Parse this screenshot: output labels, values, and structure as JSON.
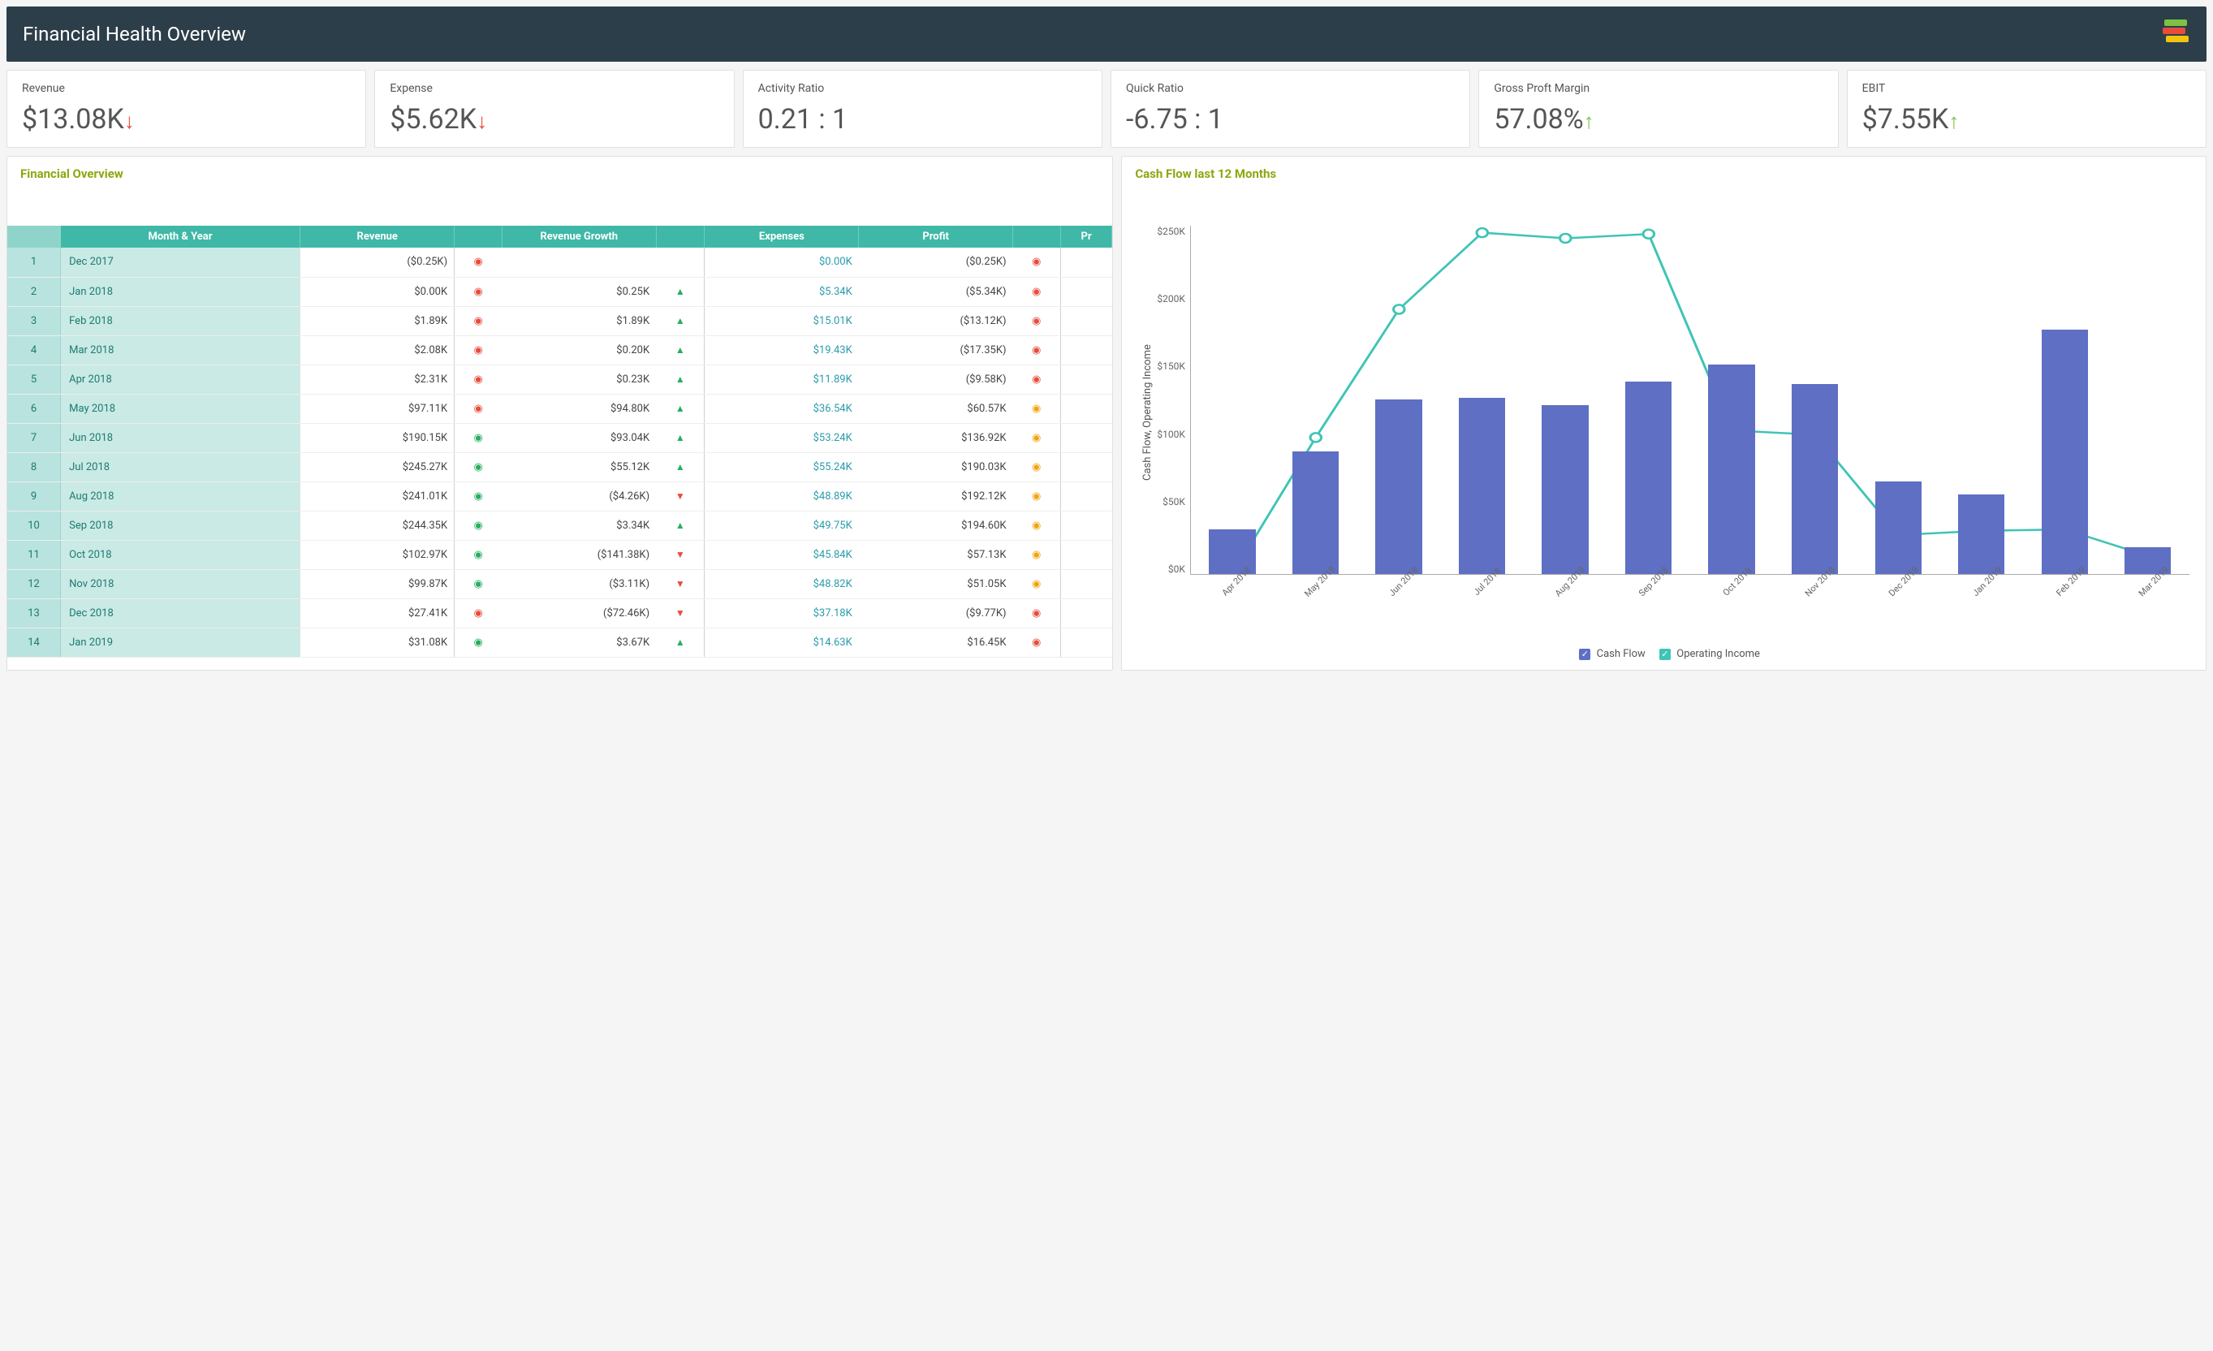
{
  "header": {
    "title": "Financial Health Overview"
  },
  "kpis": [
    {
      "label": "Revenue",
      "value": "$13.08K",
      "arrow": "down"
    },
    {
      "label": "Expense",
      "value": "$5.62K",
      "arrow": "down"
    },
    {
      "label": "Activity Ratio",
      "value": "0.21 : 1",
      "arrow": "none"
    },
    {
      "label": "Quick Ratio",
      "value": "-6.75 : 1",
      "arrow": "none"
    },
    {
      "label": "Gross Proft Margin",
      "value": "57.08%",
      "arrow": "up"
    },
    {
      "label": "EBIT",
      "value": "$7.55K",
      "arrow": "up"
    }
  ],
  "financial_overview": {
    "title": "Financial Overview",
    "columns": [
      "",
      "Month & Year",
      "Revenue",
      "",
      "Revenue Growth",
      "",
      "Expenses",
      "Profit",
      "",
      "Pr"
    ],
    "rows": [
      {
        "n": 1,
        "month": "Dec 2017",
        "rev": "($0.25K)",
        "revInd": "red",
        "growth": "",
        "growthDir": "",
        "exp": "$0.00K",
        "profit": "($0.25K)",
        "profInd": "red"
      },
      {
        "n": 2,
        "month": "Jan 2018",
        "rev": "$0.00K",
        "revInd": "red",
        "growth": "$0.25K",
        "growthDir": "up",
        "exp": "$5.34K",
        "profit": "($5.34K)",
        "profInd": "red"
      },
      {
        "n": 3,
        "month": "Feb 2018",
        "rev": "$1.89K",
        "revInd": "red",
        "growth": "$1.89K",
        "growthDir": "up",
        "exp": "$15.01K",
        "profit": "($13.12K)",
        "profInd": "red"
      },
      {
        "n": 4,
        "month": "Mar 2018",
        "rev": "$2.08K",
        "revInd": "red",
        "growth": "$0.20K",
        "growthDir": "up",
        "exp": "$19.43K",
        "profit": "($17.35K)",
        "profInd": "red"
      },
      {
        "n": 5,
        "month": "Apr 2018",
        "rev": "$2.31K",
        "revInd": "red",
        "growth": "$0.23K",
        "growthDir": "up",
        "exp": "$11.89K",
        "profit": "($9.58K)",
        "profInd": "red"
      },
      {
        "n": 6,
        "month": "May 2018",
        "rev": "$97.11K",
        "revInd": "red",
        "growth": "$94.80K",
        "growthDir": "up",
        "exp": "$36.54K",
        "profit": "$60.57K",
        "profInd": "yellow"
      },
      {
        "n": 7,
        "month": "Jun 2018",
        "rev": "$190.15K",
        "revInd": "green",
        "growth": "$93.04K",
        "growthDir": "up",
        "exp": "$53.24K",
        "profit": "$136.92K",
        "profInd": "yellow"
      },
      {
        "n": 8,
        "month": "Jul 2018",
        "rev": "$245.27K",
        "revInd": "green",
        "growth": "$55.12K",
        "growthDir": "up",
        "exp": "$55.24K",
        "profit": "$190.03K",
        "profInd": "yellow"
      },
      {
        "n": 9,
        "month": "Aug 2018",
        "rev": "$241.01K",
        "revInd": "green",
        "growth": "($4.26K)",
        "growthDir": "down",
        "exp": "$48.89K",
        "profit": "$192.12K",
        "profInd": "yellow"
      },
      {
        "n": 10,
        "month": "Sep 2018",
        "rev": "$244.35K",
        "revInd": "green",
        "growth": "$3.34K",
        "growthDir": "up",
        "exp": "$49.75K",
        "profit": "$194.60K",
        "profInd": "yellow"
      },
      {
        "n": 11,
        "month": "Oct 2018",
        "rev": "$102.97K",
        "revInd": "green",
        "growth": "($141.38K)",
        "growthDir": "down",
        "exp": "$45.84K",
        "profit": "$57.13K",
        "profInd": "yellow"
      },
      {
        "n": 12,
        "month": "Nov 2018",
        "rev": "$99.87K",
        "revInd": "green",
        "growth": "($3.11K)",
        "growthDir": "down",
        "exp": "$48.82K",
        "profit": "$51.05K",
        "profInd": "yellow"
      },
      {
        "n": 13,
        "month": "Dec 2018",
        "rev": "$27.41K",
        "revInd": "red",
        "growth": "($72.46K)",
        "growthDir": "down",
        "exp": "$37.18K",
        "profit": "($9.77K)",
        "profInd": "red"
      },
      {
        "n": 14,
        "month": "Jan 2019",
        "rev": "$31.08K",
        "revInd": "green",
        "growth": "$3.67K",
        "growthDir": "up",
        "exp": "$14.63K",
        "profit": "$16.45K",
        "profInd": "red"
      }
    ]
  },
  "chart": {
    "title": "Cash Flow last 12 Months",
    "ylabel": "Cash Flow, Operating Income",
    "legend": {
      "bar": "Cash Flow",
      "line": "Operating Income"
    }
  },
  "chart_data": {
    "type": "bar+line",
    "title": "Cash Flow last 12 Months",
    "ylabel": "Cash Flow, Operating Income",
    "xlabel": "",
    "ylim": [
      0,
      250000
    ],
    "y_ticks": [
      "$0K",
      "$50K",
      "$100K",
      "$150K",
      "$200K",
      "$250K"
    ],
    "categories": [
      "Apr 2018",
      "May 2018",
      "Jun 2018",
      "Jul 2018",
      "Aug 2018",
      "Sep 2018",
      "Oct 2018",
      "Nov 2018",
      "Dec 2018",
      "Jan 2019",
      "Feb 2019",
      "Mar 2019"
    ],
    "series": [
      {
        "name": "Cash Flow",
        "type": "bar",
        "color": "#5e6fc4",
        "values": [
          32000,
          88000,
          125000,
          126000,
          121000,
          138000,
          150000,
          136000,
          66000,
          57000,
          175000,
          19000
        ]
      },
      {
        "name": "Operating Income",
        "type": "line",
        "color": "#3fc4b5",
        "values": [
          0,
          98000,
          190000,
          245000,
          241000,
          244000,
          103000,
          100000,
          28000,
          31000,
          32000,
          13000
        ]
      }
    ]
  }
}
